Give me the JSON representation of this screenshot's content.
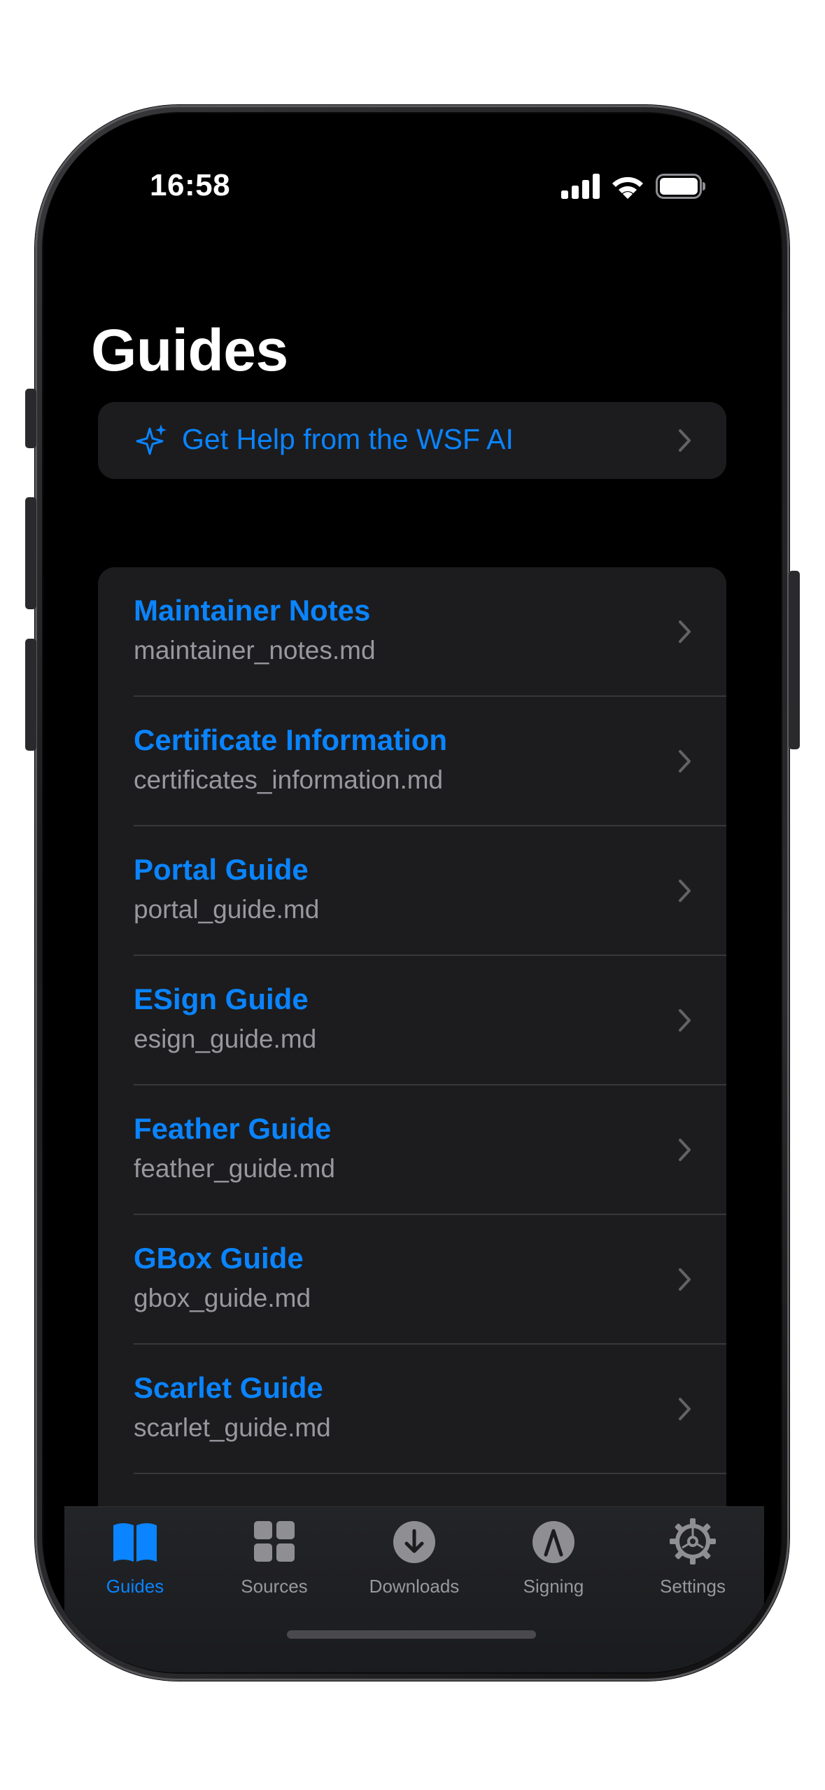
{
  "status_bar": {
    "time": "16:58"
  },
  "header": {
    "title": "Guides"
  },
  "ai_help": {
    "label": "Get Help from the WSF AI",
    "icon": "sparkle-icon"
  },
  "guides": [
    {
      "title": "Maintainer Notes",
      "file": "maintainer_notes.md"
    },
    {
      "title": "Certificate Information",
      "file": "certificates_information.md"
    },
    {
      "title": "Portal Guide",
      "file": "portal_guide.md"
    },
    {
      "title": "ESign Guide",
      "file": "esign_guide.md"
    },
    {
      "title": "Feather Guide",
      "file": "feather_guide.md"
    },
    {
      "title": "GBox Guide",
      "file": "gbox_guide.md"
    },
    {
      "title": "Scarlet Guide",
      "file": "scarlet_guide.md"
    }
  ],
  "tab_bar": {
    "items": [
      {
        "label": "Guides",
        "icon": "book-icon",
        "active": true
      },
      {
        "label": "Sources",
        "icon": "grid-icon",
        "active": false
      },
      {
        "label": "Downloads",
        "icon": "download-icon",
        "active": false
      },
      {
        "label": "Signing",
        "icon": "signing-icon",
        "active": false
      },
      {
        "label": "Settings",
        "icon": "gear-icon",
        "active": false
      }
    ]
  },
  "colors": {
    "accent": "#0a84ff",
    "background": "#000000",
    "card": "#1c1c1e",
    "secondary_text": "#98989e"
  }
}
